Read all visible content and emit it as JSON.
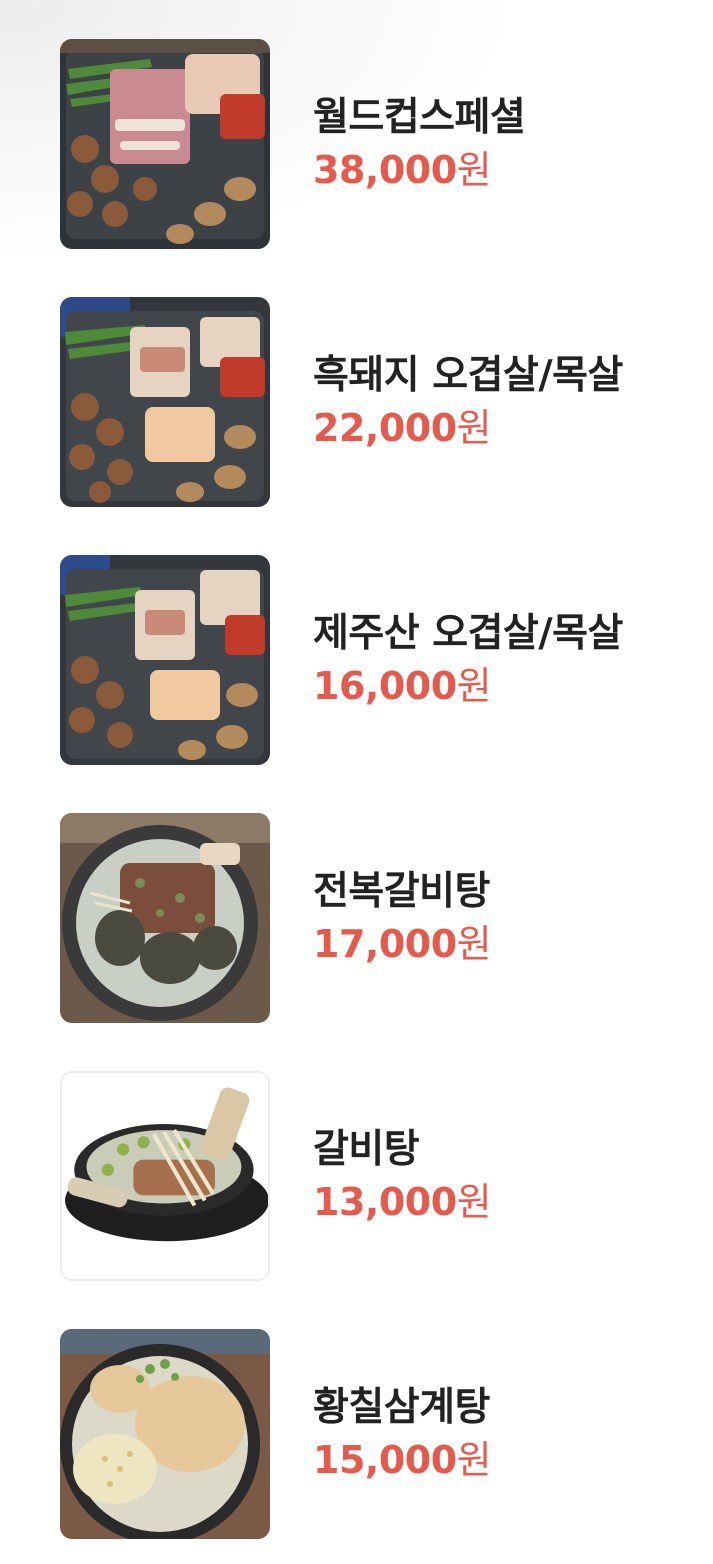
{
  "colors": {
    "name_text": "#222222",
    "price_text": "#e45a4d",
    "background": "#ffffff"
  },
  "menu": [
    {
      "name": "월드컵스페셜",
      "price": "38,000",
      "unit": "원",
      "thumbnail": "grilled-pork-platter-photo"
    },
    {
      "name": "흑돼지 오겹살/목살",
      "price": "22,000",
      "unit": "원",
      "thumbnail": "black-pork-grill-photo"
    },
    {
      "name": "제주산 오겹살/목살",
      "price": "16,000",
      "unit": "원",
      "thumbnail": "jeju-pork-grill-photo"
    },
    {
      "name": "전복갈비탕",
      "price": "17,000",
      "unit": "원",
      "thumbnail": "abalone-galbitang-photo"
    },
    {
      "name": "갈비탕",
      "price": "13,000",
      "unit": "원",
      "thumbnail": "galbitang-photo"
    },
    {
      "name": "황칠삼계탕",
      "price": "15,000",
      "unit": "원",
      "thumbnail": "samgyetang-photo"
    }
  ]
}
